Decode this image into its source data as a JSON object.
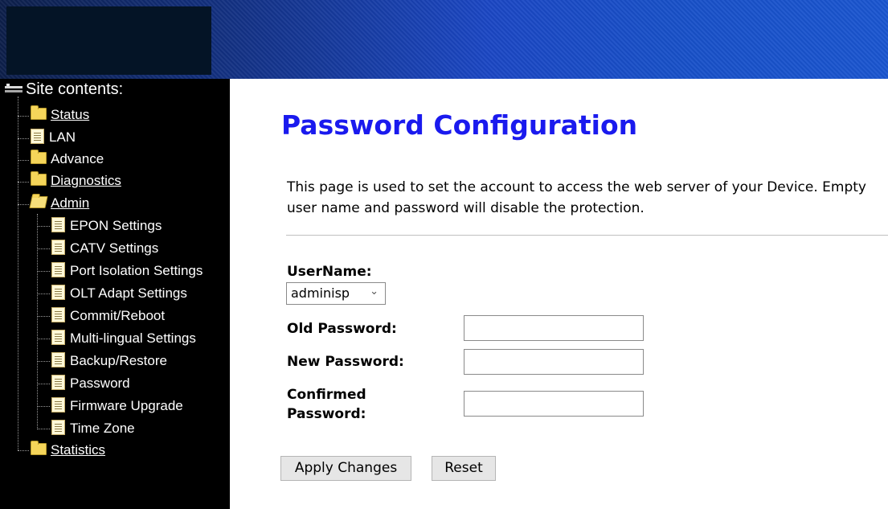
{
  "sidebar": {
    "root_label": "Site contents:",
    "items": [
      {
        "label": "Status",
        "type": "folder"
      },
      {
        "label": "LAN",
        "type": "page"
      },
      {
        "label": "Advance",
        "type": "folder"
      },
      {
        "label": "Diagnostics",
        "type": "folder"
      },
      {
        "label": "Admin",
        "type": "folder-open"
      },
      {
        "label": "Statistics",
        "type": "folder"
      }
    ],
    "admin_children": [
      {
        "label": "EPON Settings"
      },
      {
        "label": "CATV Settings"
      },
      {
        "label": "Port Isolation Settings"
      },
      {
        "label": "OLT Adapt Settings"
      },
      {
        "label": "Commit/Reboot"
      },
      {
        "label": "Multi-lingual Settings"
      },
      {
        "label": "Backup/Restore"
      },
      {
        "label": "Password"
      },
      {
        "label": "Firmware Upgrade"
      },
      {
        "label": "Time Zone"
      }
    ]
  },
  "main": {
    "title": "Password Configuration",
    "description": "This page is used to set the account to access the web server of your Device. Empty user name and password will disable the protection.",
    "form": {
      "username_label": "UserName:",
      "username_value": "adminisp",
      "old_password_label": "Old Password:",
      "old_password_value": "",
      "new_password_label": "New Password:",
      "new_password_value": "",
      "confirmed_password_label": "Confirmed Password:",
      "confirmed_password_value": "",
      "apply_label": "Apply Changes",
      "reset_label": "Reset"
    }
  },
  "icons": {
    "network": "network-icon",
    "folder": "folder-icon",
    "folder_open": "folder-open-icon",
    "page": "page-icon",
    "chevron": "chevron-down-icon"
  },
  "colors": {
    "title": "#1a1aee",
    "sidebar_bg": "#000000",
    "banner": "#1b47c4"
  }
}
